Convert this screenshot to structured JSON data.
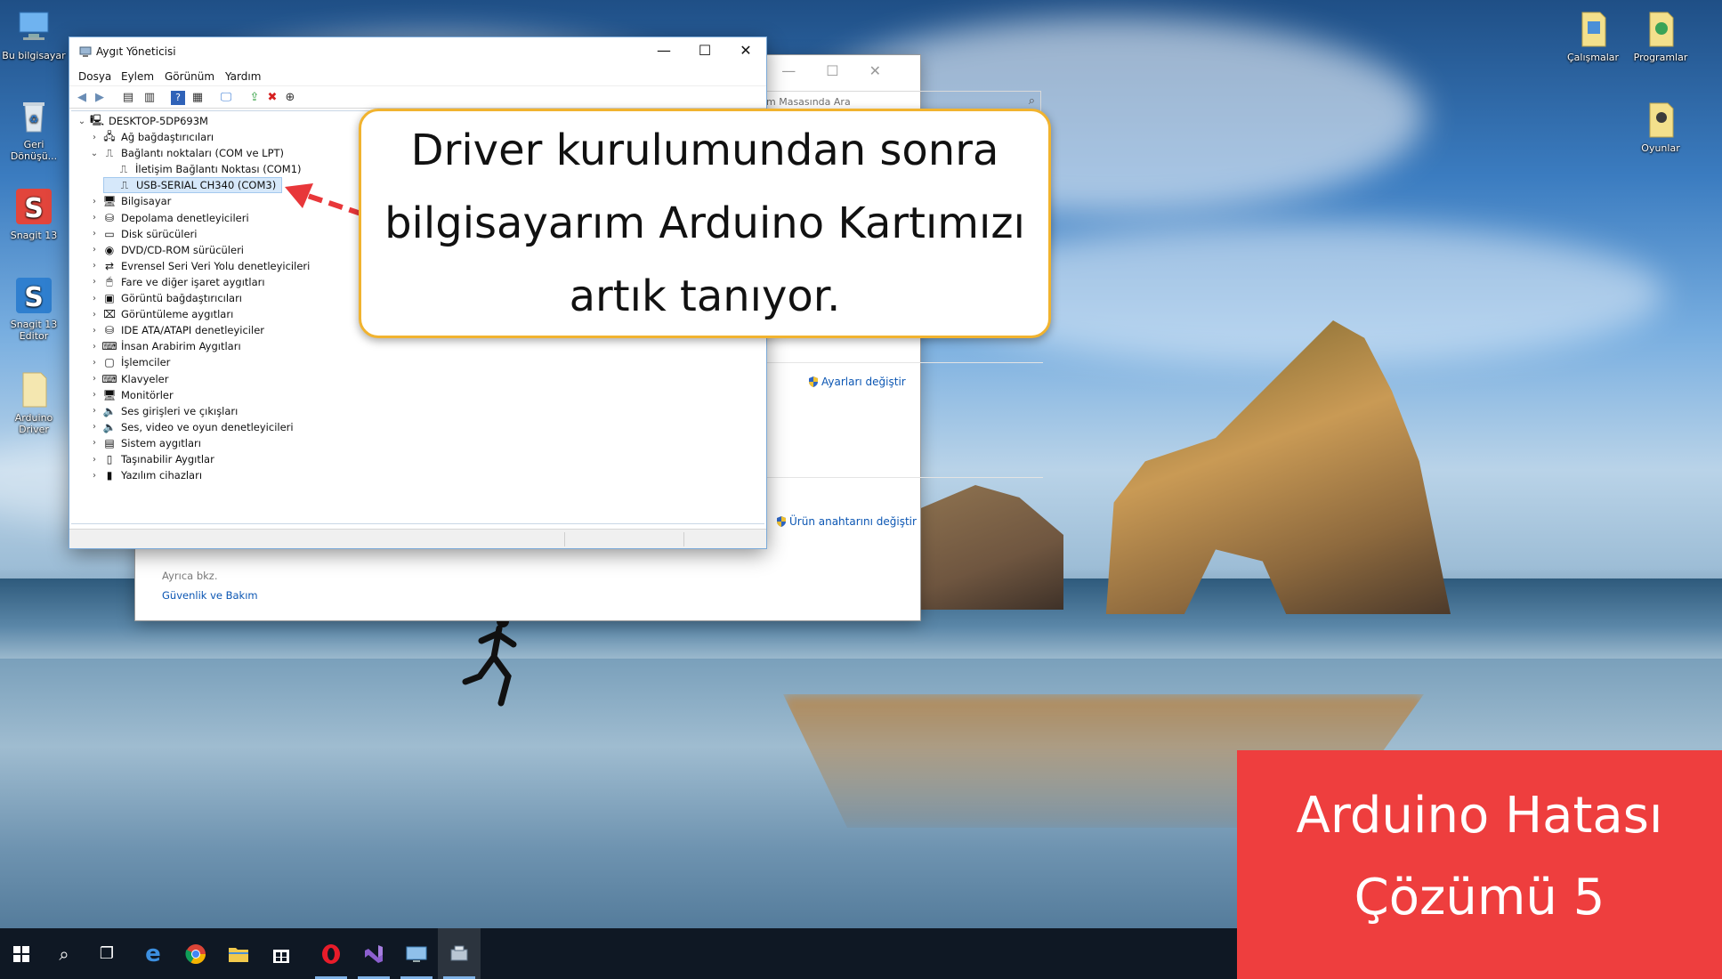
{
  "desktop": {
    "icons_left": [
      {
        "label": "Bu bilgisayar"
      },
      {
        "label": "Geri Dönüşü..."
      },
      {
        "label": "Snagit 13"
      },
      {
        "label": "Snagit 13 Editor"
      },
      {
        "label": "Arduino Driver"
      }
    ],
    "icons_right": [
      {
        "label": "Çalışmalar"
      },
      {
        "label": "Programlar"
      },
      {
        "label": "Oyunlar"
      }
    ]
  },
  "back_window": {
    "search_placeholder": "m Masasında Ara",
    "settings_link": "Ayarları değiştir",
    "product_key_link": "Ürün anahtarını değiştir",
    "see_also": "Ayrıca bkz.",
    "security_link": "Güvenlik ve Bakım"
  },
  "device_manager": {
    "title": "Aygıt Yöneticisi",
    "menu": [
      "Dosya",
      "Eylem",
      "Görünüm",
      "Yardım"
    ],
    "root": "DESKTOP-5DP693M",
    "tree": [
      {
        "label": "Ağ bağdaştırıcıları",
        "level": 1,
        "expanded": false,
        "icon": "network-icon"
      },
      {
        "label": "Bağlantı noktaları (COM ve LPT)",
        "level": 1,
        "expanded": true,
        "icon": "port-icon"
      },
      {
        "label": "İletişim Bağlantı Noktası (COM1)",
        "level": 2,
        "icon": "port-icon"
      },
      {
        "label": "USB-SERIAL CH340 (COM3)",
        "level": 2,
        "icon": "port-icon",
        "selected": true
      },
      {
        "label": "Bilgisayar",
        "level": 1,
        "expanded": false,
        "icon": "monitor-icon"
      },
      {
        "label": "Depolama denetleyicileri",
        "level": 1,
        "expanded": false,
        "icon": "storage-icon"
      },
      {
        "label": "Disk sürücüleri",
        "level": 1,
        "expanded": false,
        "icon": "disk-icon"
      },
      {
        "label": "DVD/CD-ROM sürücüleri",
        "level": 1,
        "expanded": false,
        "icon": "dvd-icon"
      },
      {
        "label": "Evrensel Seri Veri Yolu denetleyicileri",
        "level": 1,
        "expanded": false,
        "icon": "usb-icon"
      },
      {
        "label": "Fare ve diğer işaret aygıtları",
        "level": 1,
        "expanded": false,
        "icon": "mouse-icon"
      },
      {
        "label": "Görüntü bağdaştırıcıları",
        "level": 1,
        "expanded": false,
        "icon": "display-adapter-icon"
      },
      {
        "label": "Görüntüleme aygıtları",
        "level": 1,
        "expanded": false,
        "icon": "camera-icon"
      },
      {
        "label": "IDE ATA/ATAPI denetleyiciler",
        "level": 1,
        "expanded": false,
        "icon": "ide-icon"
      },
      {
        "label": "İnsan Arabirim Aygıtları",
        "level": 1,
        "expanded": false,
        "icon": "hid-icon"
      },
      {
        "label": "İşlemciler",
        "level": 1,
        "expanded": false,
        "icon": "cpu-icon"
      },
      {
        "label": "Klavyeler",
        "level": 1,
        "expanded": false,
        "icon": "keyboard-icon"
      },
      {
        "label": "Monitörler",
        "level": 1,
        "expanded": false,
        "icon": "monitor-icon"
      },
      {
        "label": "Ses girişleri ve çıkışları",
        "level": 1,
        "expanded": false,
        "icon": "speaker-icon"
      },
      {
        "label": "Ses, video ve oyun denetleyicileri",
        "level": 1,
        "expanded": false,
        "icon": "speaker-icon"
      },
      {
        "label": "Sistem aygıtları",
        "level": 1,
        "expanded": false,
        "icon": "system-icon"
      },
      {
        "label": "Taşınabilir Aygıtlar",
        "level": 1,
        "expanded": false,
        "icon": "portable-icon"
      },
      {
        "label": "Yazılım cihazları",
        "level": 1,
        "expanded": false,
        "icon": "software-device-icon"
      }
    ]
  },
  "callout": {
    "line1": "Driver kurulumundan sonra",
    "line2": "bilgisayarım Arduino Kartımızı",
    "line3": "artık tanıyor."
  },
  "badge": {
    "line1": "Arduino Hatası",
    "line2": "Çözümü 5"
  },
  "taskbar": {
    "items": [
      "start-icon",
      "search-icon",
      "task-view-icon",
      "edge-icon",
      "chrome-icon",
      "file-explorer-icon",
      "store-icon",
      "opera-icon",
      "visual-studio-icon",
      "remote-desktop-icon",
      "device-manager-icon"
    ]
  },
  "colors": {
    "callout_border": "#f1b32f",
    "badge_background": "#ee3e3e",
    "selection": "#d6e8fa",
    "link": "#0b56b3",
    "taskbar": "#0f1824"
  }
}
